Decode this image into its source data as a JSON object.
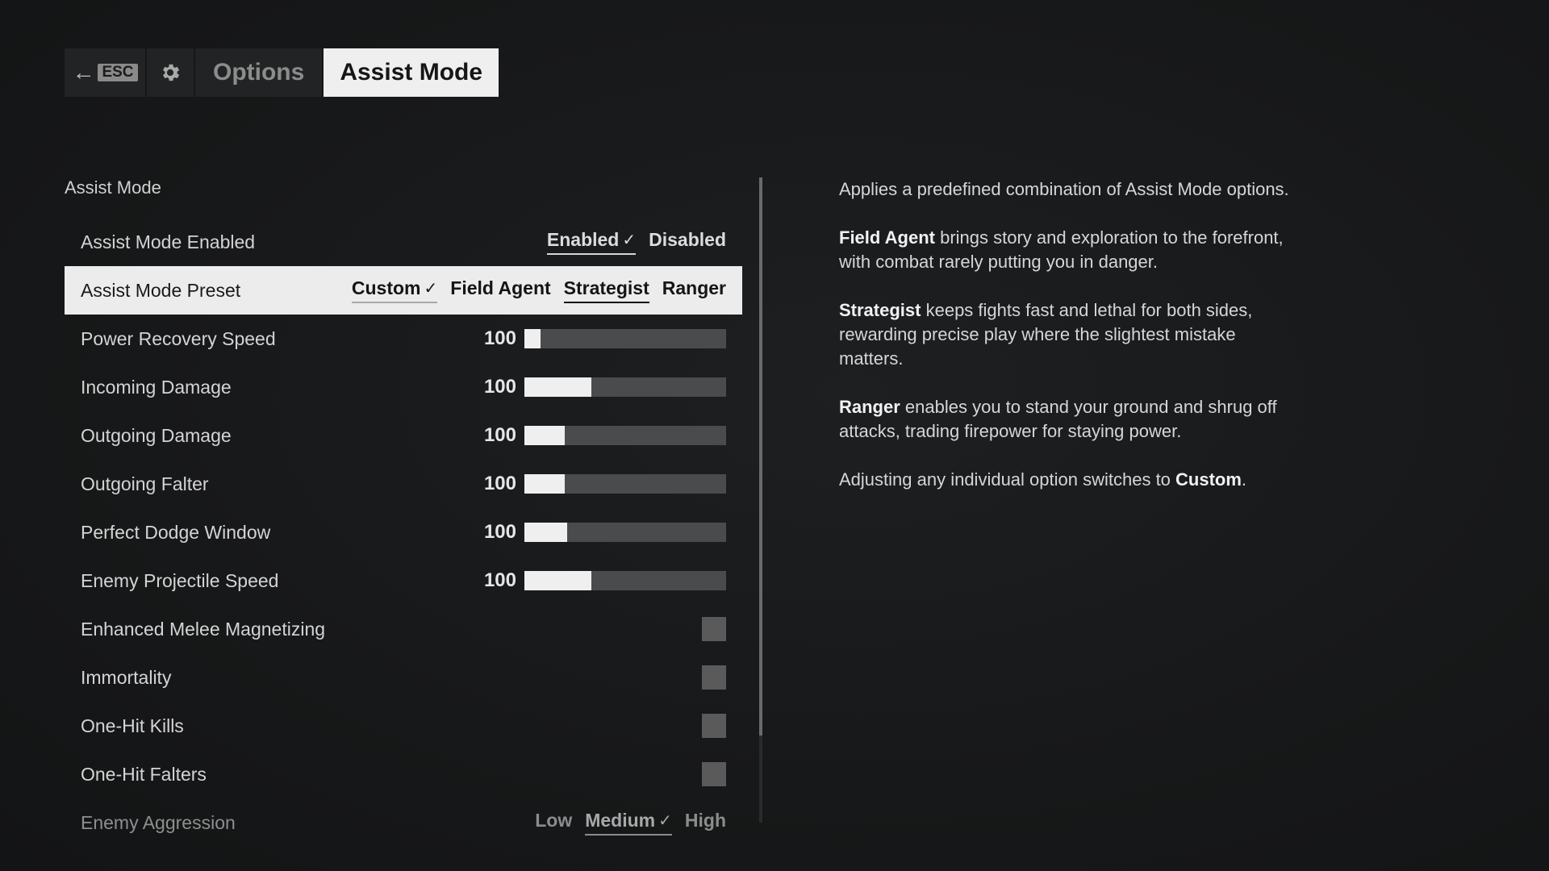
{
  "header": {
    "back_key": "ESC",
    "options_label": "Options",
    "active_label": "Assist Mode"
  },
  "section": {
    "title": "Assist Mode"
  },
  "rows": [
    {
      "label": "Assist Mode Enabled",
      "options": [
        "Enabled",
        "Disabled"
      ],
      "selected": "Enabled"
    },
    {
      "label": "Assist Mode Preset",
      "options": [
        "Custom",
        "Field Agent",
        "Strategist",
        "Ranger"
      ],
      "selected": "Custom",
      "highlighted": "Strategist"
    },
    {
      "label": "Power Recovery Speed",
      "value": "100",
      "fill": 0.08
    },
    {
      "label": "Incoming Damage",
      "value": "100",
      "fill": 0.33
    },
    {
      "label": "Outgoing Damage",
      "value": "100",
      "fill": 0.2
    },
    {
      "label": "Outgoing Falter",
      "value": "100",
      "fill": 0.2
    },
    {
      "label": "Perfect Dodge Window",
      "value": "100",
      "fill": 0.21
    },
    {
      "label": "Enemy Projectile Speed",
      "value": "100",
      "fill": 0.33
    },
    {
      "label": "Enhanced Melee Magnetizing",
      "checked": false
    },
    {
      "label": "Immortality",
      "checked": false
    },
    {
      "label": "One-Hit Kills",
      "checked": false
    },
    {
      "label": "One-Hit Falters",
      "checked": false
    },
    {
      "label": "Enemy Aggression",
      "options": [
        "Low",
        "Medium",
        "High"
      ],
      "selected": "Medium"
    }
  ],
  "description": {
    "intro": "Applies a predefined combination of Assist Mode options.",
    "field_agent_name": "Field Agent",
    "field_agent_text": " brings story and exploration to the forefront, with combat rarely putting you in danger.",
    "strategist_name": "Strategist",
    "strategist_text": " keeps fights fast and lethal for both sides, rewarding precise play where the slightest mistake matters.",
    "ranger_name": "Ranger",
    "ranger_text": " enables you to stand your ground and shrug off attacks, trading firepower for staying power.",
    "custom_prefix": "Adjusting any individual option switches to ",
    "custom_name": "Custom",
    "custom_suffix": "."
  },
  "colors": {
    "background": "#161718",
    "selected_row": "#ececec",
    "slider_fill": "#efefef",
    "slider_track": "#4a4b4c"
  }
}
